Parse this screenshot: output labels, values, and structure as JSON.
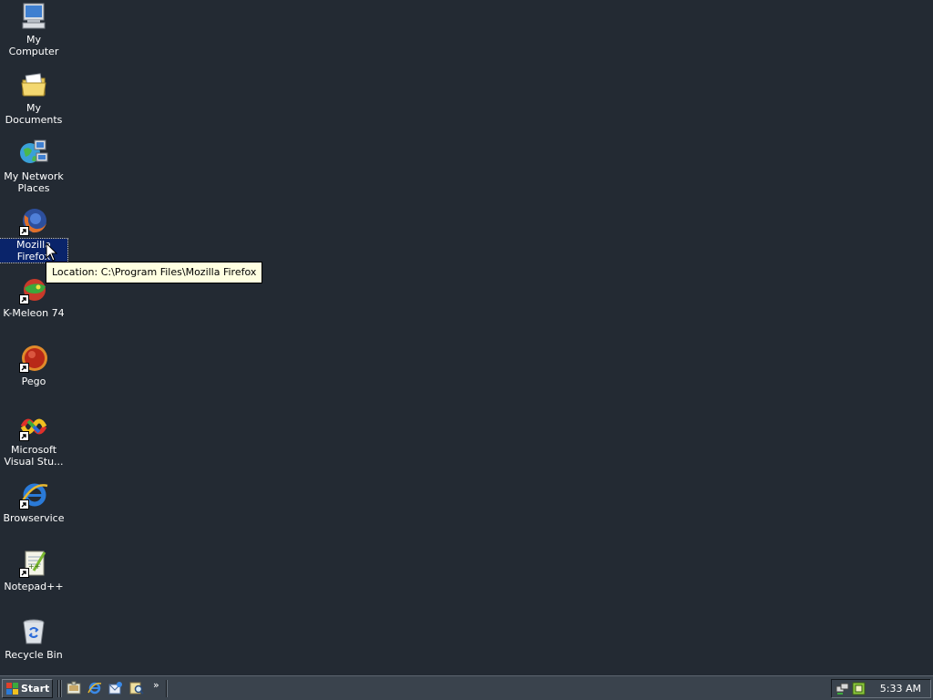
{
  "desktop": {
    "icons": [
      {
        "label": "My Computer",
        "icon": "my-computer-icon",
        "shortcut": false,
        "selected": false
      },
      {
        "label": "My Documents",
        "icon": "folder-icon",
        "shortcut": false,
        "selected": false
      },
      {
        "label": "My Network\nPlaces",
        "icon": "network-places-icon",
        "shortcut": false,
        "selected": false
      },
      {
        "label": "Mozilla Firefox",
        "icon": "firefox-icon",
        "shortcut": true,
        "selected": true
      },
      {
        "label": "K-Meleon 74",
        "icon": "k-meleon-icon",
        "shortcut": true,
        "selected": false
      },
      {
        "label": "Pego",
        "icon": "pego-icon",
        "shortcut": true,
        "selected": false
      },
      {
        "label": "Microsoft\nVisual Stu...",
        "icon": "visual-studio-icon",
        "shortcut": true,
        "selected": false
      },
      {
        "label": "Browservice",
        "icon": "internet-explorer-icon",
        "shortcut": true,
        "selected": false
      },
      {
        "label": "Notepad++",
        "icon": "notepad-plus-plus-icon",
        "shortcut": true,
        "selected": false
      },
      {
        "label": "Recycle Bin",
        "icon": "recycle-bin-icon",
        "shortcut": false,
        "selected": false
      }
    ],
    "tooltip": "Location: C:\\Program Files\\Mozilla Firefox"
  },
  "taskbar": {
    "start_label": "Start",
    "quick_launch": [
      "show-desktop-icon",
      "internet-explorer-icon",
      "outlook-express-icon",
      "search-icon"
    ],
    "chevron": "»",
    "tray_icons": [
      "network-icon",
      "volume-icon"
    ],
    "clock": "5:33 AM"
  },
  "colors": {
    "desktop_bg": "#232a33",
    "taskbar_bg": "#3a434d",
    "selection": "#0a246a",
    "tooltip_bg": "#ffffe1"
  }
}
